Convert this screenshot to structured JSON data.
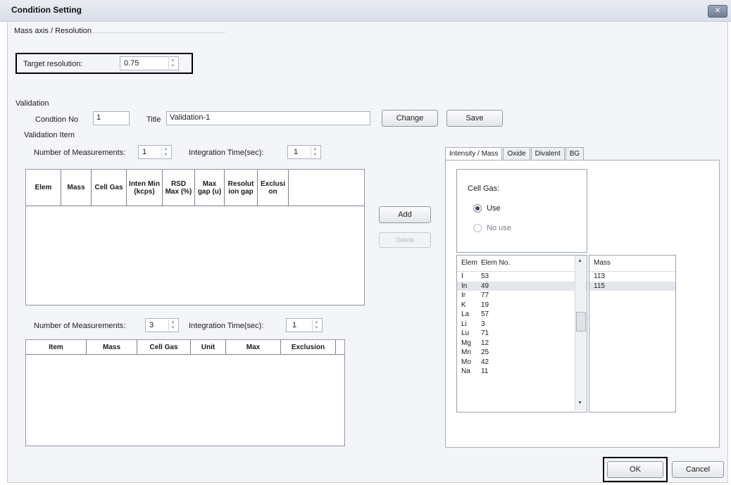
{
  "window": {
    "title": "Condition Setting",
    "close": "✕"
  },
  "mass_axis": {
    "group_label": "Mass axis / Resolution",
    "target_label": "Target resolution:",
    "target_value": "0.75"
  },
  "validation": {
    "group_label": "Validation",
    "condition_no_label": "Condtion No",
    "condition_no_value": "1",
    "title_label": "Title",
    "title_value": "Validation-1",
    "change_button": "Change",
    "save_button": "Save",
    "item_label": "Validation Item"
  },
  "upper": {
    "num_meas_label": "Number of Measurements:",
    "num_meas_value": "1",
    "int_time_label": "Integration Time(sec):",
    "int_time_value": "1",
    "columns": [
      "Elem",
      "Mass",
      "Cell Gas",
      "Inten Min (kcps)",
      "RSD Max (%)",
      "Max gap (u)",
      "Resolut ion gap",
      "Exclusi on"
    ]
  },
  "lower": {
    "num_meas_label": "Number of Measurements:",
    "num_meas_value": "3",
    "int_time_label": "Integration Time(sec):",
    "int_time_value": "1",
    "columns": [
      "Item",
      "Mass",
      "Cell Gas",
      "Unit",
      "Max",
      "Exclusion"
    ]
  },
  "actions": {
    "add": "Add",
    "delete": "Delete"
  },
  "tabs": [
    {
      "label": "Intensity / Mass"
    },
    {
      "label": "Oxide"
    },
    {
      "label": "Divalent"
    },
    {
      "label": "BG"
    }
  ],
  "cell_gas": {
    "label": "Cell Gas:",
    "use": "Use",
    "no_use": "No use"
  },
  "elem_list": {
    "headers": [
      "Elem",
      "Elem No."
    ],
    "rows": [
      {
        "elem": "I",
        "no": "53"
      },
      {
        "elem": "In",
        "no": "49"
      },
      {
        "elem": "Ir",
        "no": "77"
      },
      {
        "elem": "K",
        "no": "19"
      },
      {
        "elem": "La",
        "no": "57"
      },
      {
        "elem": "Li",
        "no": "3"
      },
      {
        "elem": "Lu",
        "no": "71"
      },
      {
        "elem": "Mg",
        "no": "12"
      },
      {
        "elem": "Mn",
        "no": "25"
      },
      {
        "elem": "Mo",
        "no": "42"
      },
      {
        "elem": "Na",
        "no": "11"
      }
    ]
  },
  "mass_list": {
    "header": "Mass",
    "rows": [
      "113",
      "115"
    ]
  },
  "footer": {
    "ok": "OK",
    "cancel": "Cancel"
  }
}
